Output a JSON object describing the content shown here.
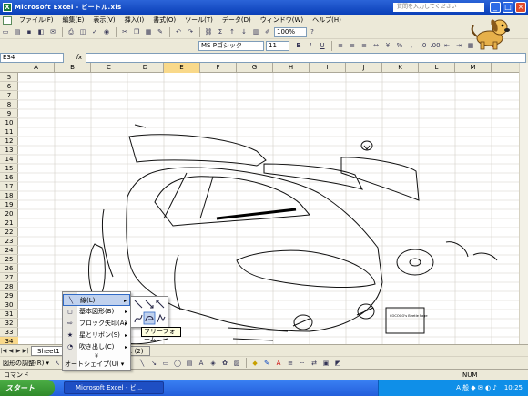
{
  "window": {
    "title": "Microsoft Excel - ビートル.xls",
    "help_placeholder": "質問を入力してください"
  },
  "menu": [
    "ファイル(F)",
    "編集(E)",
    "表示(V)",
    "挿入(I)",
    "書式(O)",
    "ツール(T)",
    "データ(D)",
    "ウィンドウ(W)",
    "ヘルプ(H)"
  ],
  "toolbar": {
    "zoom": "100%",
    "font": "MS Pゴシック",
    "size": "11",
    "bold": "B",
    "italic": "I",
    "underline": "U"
  },
  "formula": {
    "cell_ref": "E34",
    "fx": "fx",
    "value": ""
  },
  "columns": [
    "A",
    "B",
    "C",
    "D",
    "E",
    "F",
    "G",
    "H",
    "I",
    "J",
    "K",
    "L",
    "M"
  ],
  "rows": [
    "5",
    "6",
    "7",
    "8",
    "9",
    "10",
    "11",
    "12",
    "13",
    "14",
    "15",
    "16",
    "17",
    "18",
    "19",
    "20",
    "21",
    "22",
    "23",
    "24",
    "25",
    "26",
    "27",
    "28",
    "29",
    "30",
    "31",
    "32",
    "33",
    "34"
  ],
  "sheet_tabs": [
    "Sheet1 (",
    "Sheet1 (2)"
  ],
  "drawing": {
    "draw_menu": "図形の調整(R) ▾",
    "autoshape": "オートシェイプ(U) ▾"
  },
  "shape_menu": [
    {
      "label": "線(L)",
      "icon": "line-icon"
    },
    {
      "label": "基本図形(B)",
      "icon": "basic-shapes-icon"
    },
    {
      "label": "ブロック矢印(A)",
      "icon": "block-arrow-icon"
    },
    {
      "label": "星とリボン(S)",
      "icon": "star-icon"
    },
    {
      "label": "吹き出し(C)",
      "icon": "callout-icon"
    }
  ],
  "tooltip": "フリーフォーム",
  "status": {
    "left": "コマンド",
    "num": "NUM"
  },
  "taskbar": {
    "start": "スタート",
    "task": "Microsoft Excel - ビ...",
    "clock": "10:25"
  },
  "drawing_label": "COCOGO's Beetle Page"
}
